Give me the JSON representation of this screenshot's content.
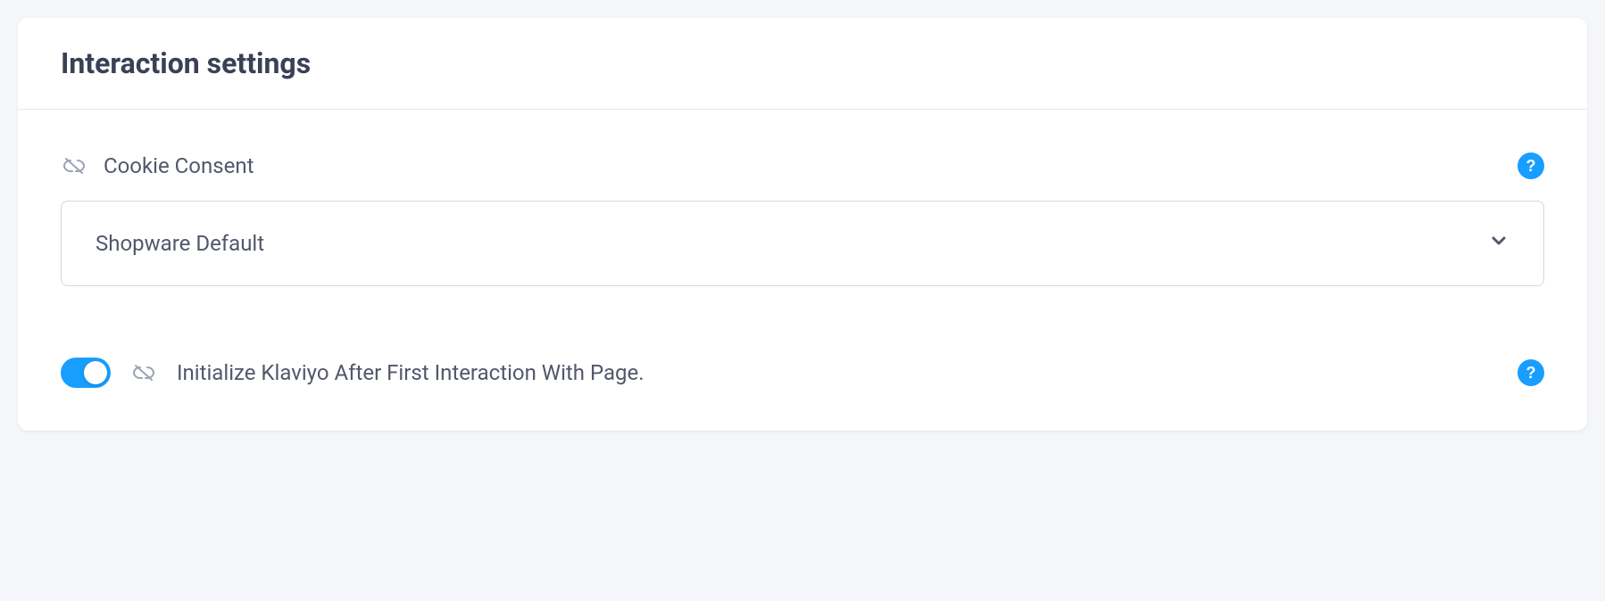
{
  "card": {
    "title": "Interaction settings"
  },
  "cookieConsent": {
    "label": "Cookie Consent",
    "selectedValue": "Shopware Default"
  },
  "initToggle": {
    "label": "Initialize Klaviyo After First Interaction With Page.",
    "enabled": true
  },
  "help": {
    "symbol": "?"
  }
}
